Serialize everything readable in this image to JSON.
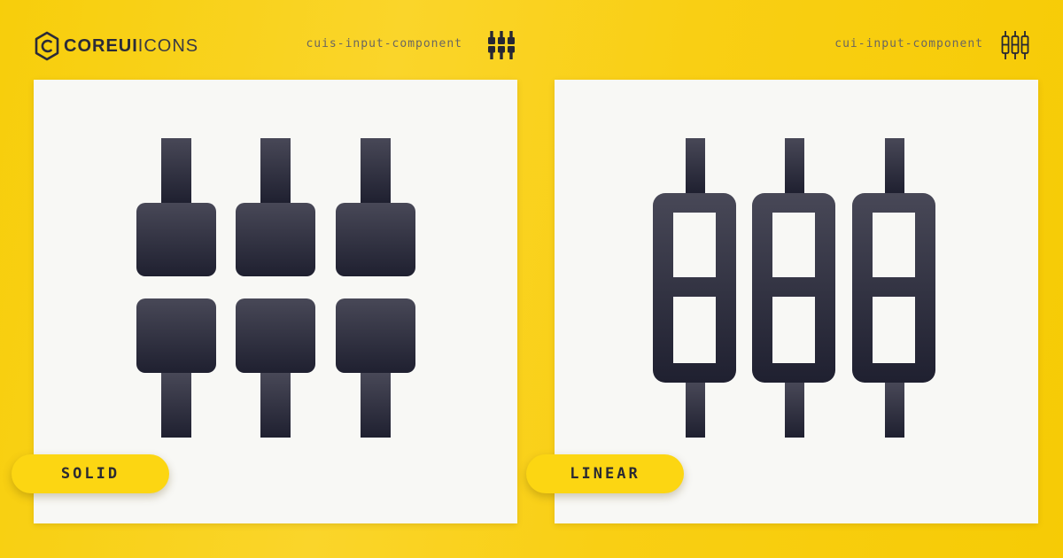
{
  "brand": {
    "name_bold": "COREUI",
    "name_light": "ICONS",
    "logo_icon": "coreui-hexagon-logo"
  },
  "solid": {
    "icon_name": "cuis-input-component",
    "label": "SOLID",
    "icon": "input-component-solid-icon"
  },
  "linear": {
    "icon_name": "cui-input-component",
    "label": "LINEAR",
    "icon": "input-component-linear-icon"
  },
  "colors": {
    "background": "#f8cf10",
    "card": "#f8f8f5",
    "pill": "#fcd612",
    "icon_top": "#484857",
    "icon_bottom": "#1f2030"
  }
}
